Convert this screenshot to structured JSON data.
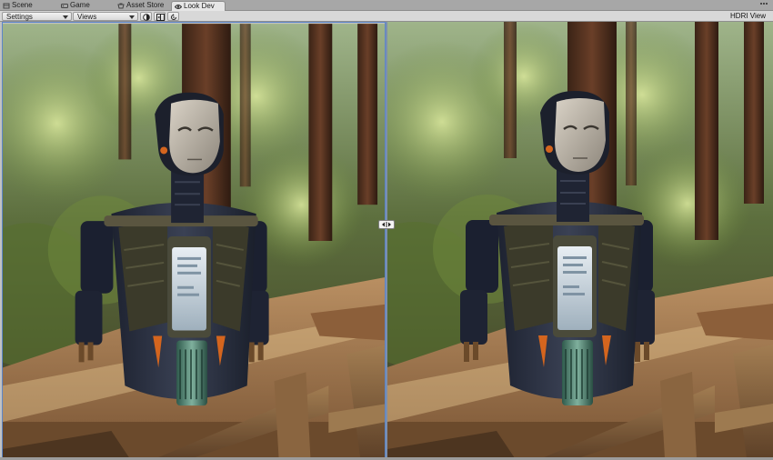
{
  "tabs": [
    {
      "label": "Scene",
      "icon": "scene-icon",
      "active": false
    },
    {
      "label": "Game",
      "icon": "game-icon",
      "active": false
    },
    {
      "label": "Asset Store",
      "icon": "store-icon",
      "active": false
    },
    {
      "label": "Look Dev",
      "icon": "eye-icon",
      "active": true
    }
  ],
  "toolbar": {
    "settings_label": "Settings",
    "views_label": "Views",
    "shading_icon": "shading-toggle-icon",
    "compare_icon": "side-by-side-icon",
    "reset_icon": "reset-view-icon",
    "hdri_label": "HDRI View"
  },
  "views": {
    "left": {
      "name": "view-a",
      "content": "robot-in-forest"
    },
    "right": {
      "name": "view-b",
      "content": "robot-in-forest"
    }
  },
  "colors": {
    "accent": "#5c86c9",
    "tab_active": "#e6e6e6",
    "toolbar": "#d8d8d8"
  }
}
